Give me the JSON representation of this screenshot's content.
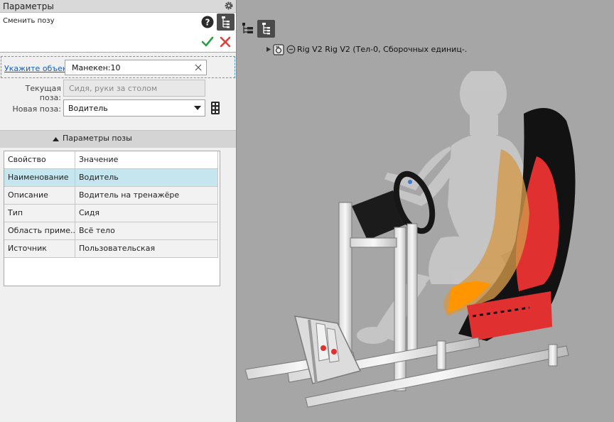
{
  "panel": {
    "title": "Параметры",
    "command_name": "Сменить позу",
    "select_link": "Укажите объект",
    "object_value": "Манекен:10",
    "current_pose_label": "Текущая поза:",
    "current_pose_value": "Сидя, руки за столом",
    "new_pose_label": "Новая поза:",
    "new_pose_value": "Водитель",
    "section_title": "Параметры позы",
    "table": {
      "headers": [
        "Свойство",
        "Значение"
      ],
      "rows": [
        [
          "Наименование",
          "Водитель"
        ],
        [
          "Описание",
          "Водитель на тренажёре"
        ],
        [
          "Тип",
          "Сидя"
        ],
        [
          "Область приме...",
          "Всё тело"
        ],
        [
          "Источник",
          "Пользовательская"
        ]
      ],
      "selected_row": 0
    }
  },
  "viewport": {
    "tree_item_label": "Rig V2 Rig V2 (Тел-0, Сборочных единиц-."
  },
  "colors": {
    "accent_selection": "#c6e6ef",
    "ok_green": "#2e9f45",
    "cancel_red": "#e0403a",
    "link_blue": "#1a5fb4"
  },
  "icons": [
    "gear-icon",
    "help-icon",
    "tree-view-icon",
    "ok-icon",
    "cancel-icon",
    "clear-icon",
    "dropdown-arrow-icon",
    "pose-library-icon",
    "chevron-up-icon",
    "assembly-icon"
  ]
}
